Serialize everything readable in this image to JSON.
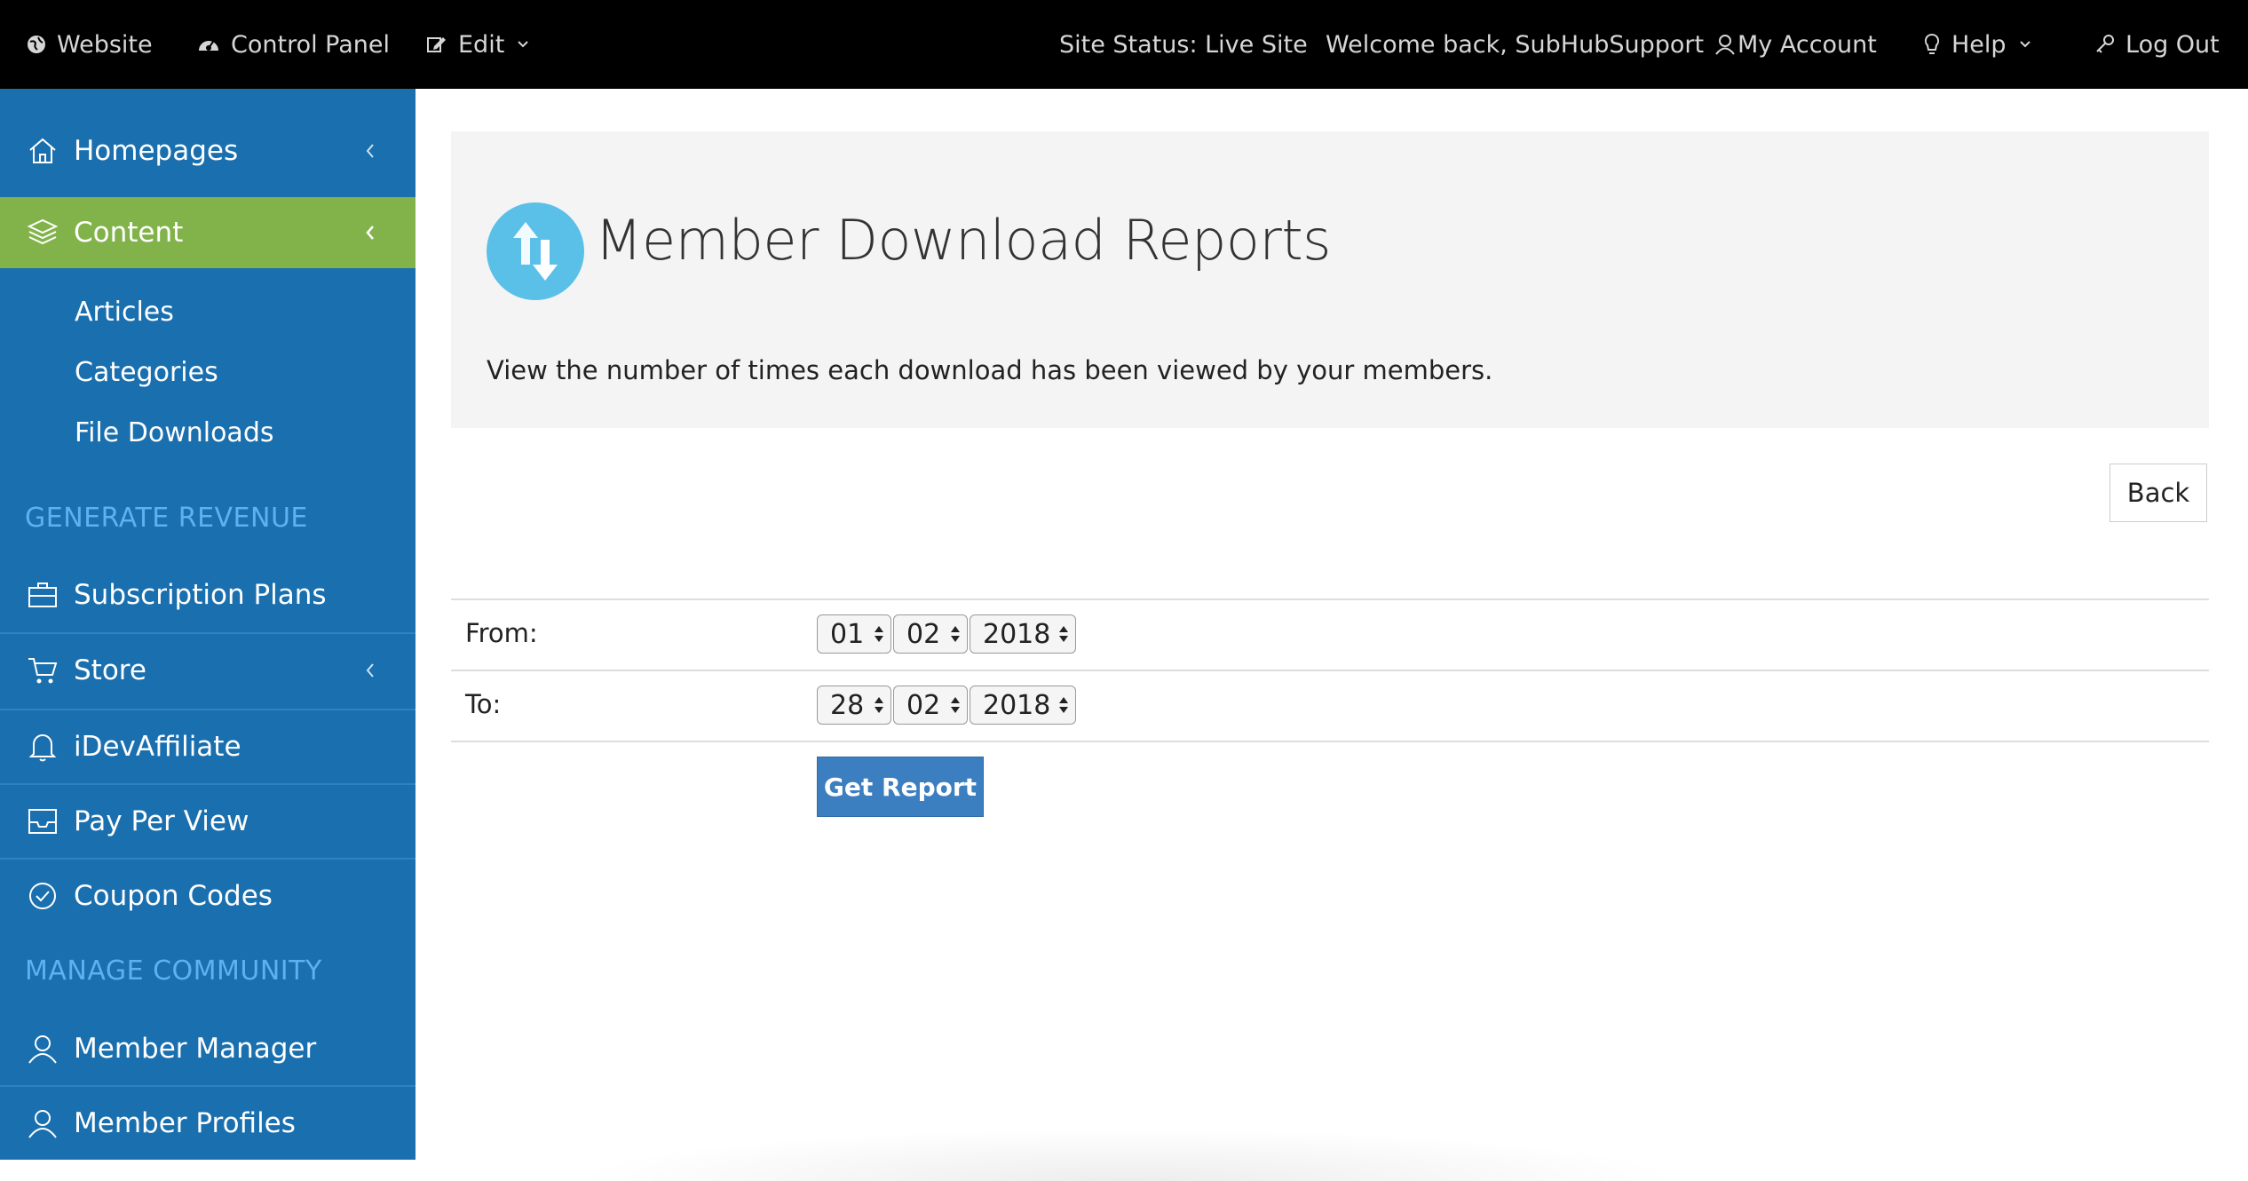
{
  "topbar": {
    "website": "Website",
    "control_panel": "Control Panel",
    "edit": "Edit",
    "site_status": "Site Status: Live Site",
    "welcome": "Welcome back, SubHubSupport",
    "my_account": "My Account",
    "help": "Help",
    "log_out": "Log Out"
  },
  "sidebar": {
    "homepages": "Homepages",
    "content": "Content",
    "content_sub": [
      "Articles",
      "Categories",
      "File Downloads"
    ],
    "section_revenue": "GENERATE REVENUE",
    "subscription_plans": "Subscription Plans",
    "store": "Store",
    "idevaffiliate": "iDevAffiliate",
    "pay_per_view": "Pay Per View",
    "coupon_codes": "Coupon Codes",
    "section_community": "MANAGE COMMUNITY",
    "member_manager": "Member Manager",
    "member_profiles": "Member Profiles"
  },
  "main": {
    "title": "Member Download Reports",
    "description": "View the number of times each download has been viewed by your members.",
    "back": "Back",
    "from_label": "From:",
    "to_label": "To:",
    "from": {
      "day": "01",
      "month": "02",
      "year": "2018"
    },
    "to": {
      "day": "28",
      "month": "02",
      "year": "2018"
    },
    "get_report": "Get Report"
  },
  "colors": {
    "topbar_bg": "#000000",
    "sidebar_bg": "#1a6faf",
    "active_item_bg": "#82b34b",
    "section_header": "#5fb0ee",
    "header_panel_bg": "#f4f4f4",
    "icon_circle": "#5bc0e8",
    "primary_button": "#3c7fc1"
  }
}
